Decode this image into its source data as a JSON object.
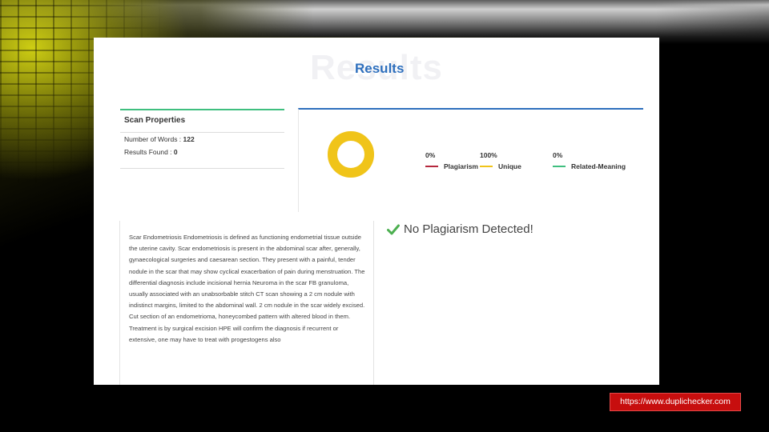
{
  "results": {
    "watermark": "Results",
    "title": "Results"
  },
  "scan_properties": {
    "heading": "Scan Properties",
    "words_label": "Number of Words : ",
    "words_value": "122",
    "results_label": "Results Found : ",
    "results_value": "0"
  },
  "stats": [
    {
      "percent": "0%",
      "label": "Plagiarism",
      "color": "#b5283d"
    },
    {
      "percent": "100%",
      "label": "Unique",
      "color": "#f0c419"
    },
    {
      "percent": "0%",
      "label": "Related-Meaning",
      "color": "#3fbf7f"
    }
  ],
  "chart": {
    "unique_fraction": 1.0,
    "ring_color": "#f0c419"
  },
  "document_text": "Scar Endometriosis Endometriosis is defined as functioning endometrial tissue outside the uterine cavity. Scar endometriosis is present in the abdominal scar after, generally, gynaecological surgeries and caesarean section. They present with a painful, tender nodule in the scar that may show cyclical exacerbation of pain during menstruation. The differential diagnosis include incisional hernia Neuroma in the scar FB granuloma, usually associated with an unabsorbable stitch CT scan showing a 2 cm nodule with indistinct margins, limited to the abdominal wall. 2 cm nodule in the scar widely excised. Cut section of an endometrioma, honeycombed pattern with altered blood in them. Treatment is by surgical excision HPE will confirm the diagnosis if recurrent or extensive, one may have to treat with progestogens also",
  "verdict": {
    "text": "No Plagiarism Detected!",
    "icon": "checkmark-icon",
    "color": "#4caf50"
  },
  "source_label": "https://www.duplichecker.com"
}
